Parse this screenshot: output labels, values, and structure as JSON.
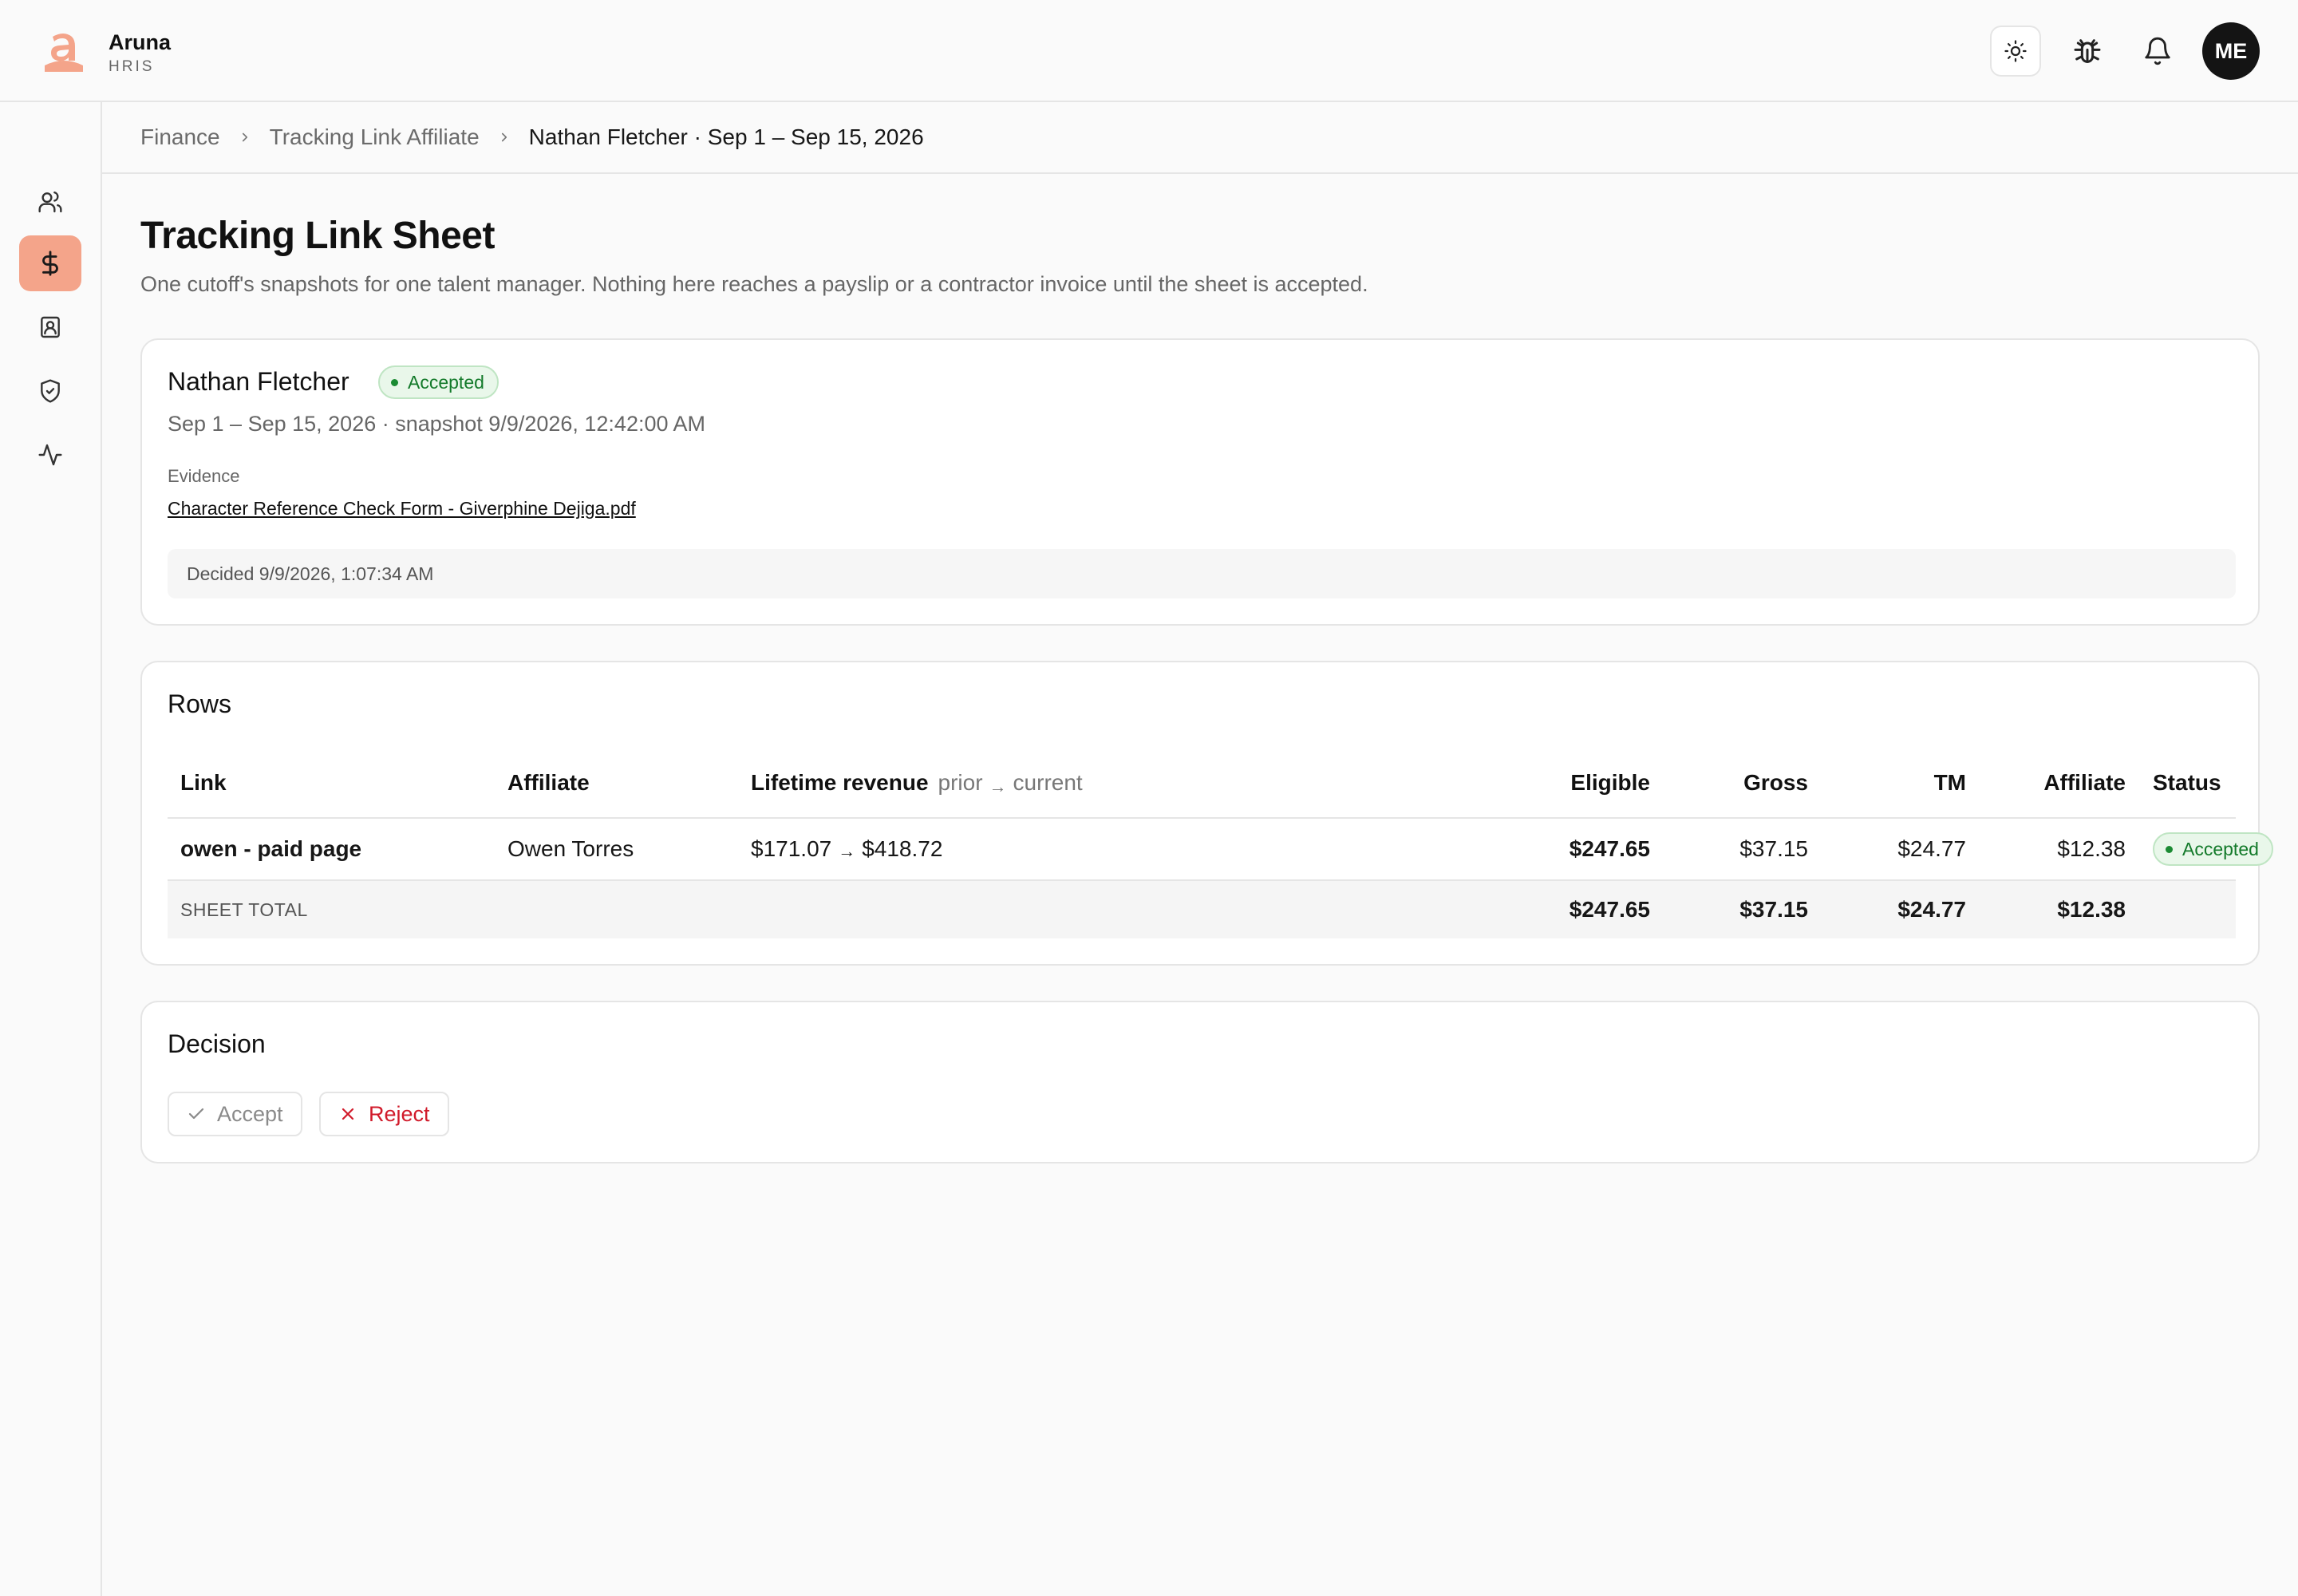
{
  "app": {
    "name": "Aruna",
    "subtitle": "HRIS",
    "accent": "#f4a48a"
  },
  "header": {
    "user_initials": "ME",
    "icons": [
      "sun-icon",
      "bug-icon",
      "bell-icon"
    ]
  },
  "sidebar": {
    "items": [
      {
        "icon": "users-icon",
        "active": false
      },
      {
        "icon": "dollar-icon",
        "active": true
      },
      {
        "icon": "contact-card-icon",
        "active": false
      },
      {
        "icon": "shield-check-icon",
        "active": false
      },
      {
        "icon": "activity-icon",
        "active": false
      }
    ]
  },
  "breadcrumb": {
    "items": [
      "Finance",
      "Tracking Link Affiliate",
      "Nathan Fletcher · Sep 1 – Sep 15, 2026"
    ]
  },
  "page": {
    "title": "Tracking Link Sheet",
    "subtitle": "One cutoff's snapshots for one talent manager. Nothing here reaches a payslip or a contractor invoice until the sheet is accepted."
  },
  "sheet": {
    "person": "Nathan Fletcher",
    "status": "Accepted",
    "meta": "Sep 1 – Sep 15, 2026 · snapshot 9/9/2026, 12:42:00 AM",
    "evidence_label": "Evidence",
    "evidence_file": "Character Reference Check Form - Giverphine Dejiga.pdf",
    "decided": "Decided 9/9/2026, 1:07:34 AM"
  },
  "rows": {
    "title": "Rows",
    "columns": {
      "link": "Link",
      "affiliate": "Affiliate",
      "lifetime": "Lifetime revenue",
      "lifetime_hint_prior": "prior",
      "lifetime_hint_current": "current",
      "eligible": "Eligible",
      "gross": "Gross",
      "tm": "TM",
      "affiliate_share": "Affiliate",
      "status": "Status"
    },
    "data": [
      {
        "link": "owen - paid page",
        "affiliate": "Owen Torres",
        "prior": "$171.07",
        "current": "$418.72",
        "eligible": "$247.65",
        "gross": "$37.15",
        "tm": "$24.77",
        "affiliate_share": "$12.38",
        "status": "Accepted"
      }
    ],
    "total": {
      "label": "SHEET TOTAL",
      "eligible": "$247.65",
      "gross": "$37.15",
      "tm": "$24.77",
      "affiliate_share": "$12.38"
    }
  },
  "decision": {
    "title": "Decision",
    "accept_label": "Accept",
    "reject_label": "Reject"
  }
}
